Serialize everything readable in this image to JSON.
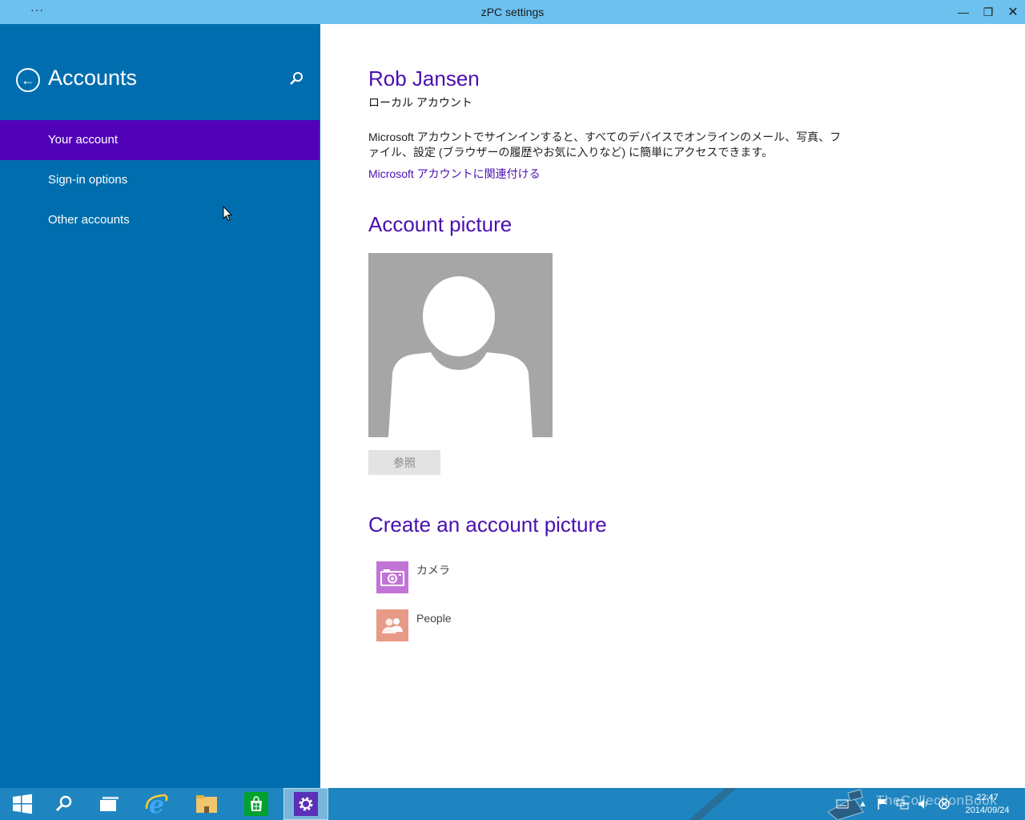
{
  "window": {
    "title": "zPC settings",
    "menu_label": "···",
    "minimize_glyph": "—",
    "maximize_glyph": "❐",
    "close_glyph": "✕"
  },
  "sidebar": {
    "heading": "Accounts",
    "back_glyph": "←",
    "items": [
      {
        "label": "Your account",
        "active": true
      },
      {
        "label": "Sign-in options",
        "active": false
      },
      {
        "label": "Other accounts",
        "active": false
      }
    ]
  },
  "main": {
    "user_name": "Rob Jansen",
    "account_type": "ローカル アカウント",
    "description": "Microsoft アカウントでサインインすると、すべてのデバイスでオンラインのメール、写真、ファイル、設定 (ブラウザーの履歴やお気に入りなど) に簡単にアクセスできます。",
    "link_label": "Microsoft アカウントに関連付ける",
    "account_picture_title": "Account picture",
    "browse_label": "参照",
    "create_picture_title": "Create an account picture",
    "apps": [
      {
        "label": "カメラ",
        "icon": "camera-icon",
        "color": "#c274d6"
      },
      {
        "label": "People",
        "icon": "people-icon",
        "color": "#e79a86"
      }
    ]
  },
  "taskbar": {
    "apps": [
      "start-icon",
      "search-icon",
      "task-view-icon",
      "internet-explorer-icon",
      "file-explorer-icon",
      "store-icon",
      "settings-icon"
    ],
    "watermark": "TheCollectionBook",
    "clock_time": "22:47",
    "clock_date": "2014/09/24"
  },
  "colors": {
    "title_bar": "#6cc1ef",
    "sidebar": "#006eae",
    "nav_active": "#5102b8",
    "accent_text": "#4a0fb0",
    "taskbar": "#1f85c0"
  }
}
